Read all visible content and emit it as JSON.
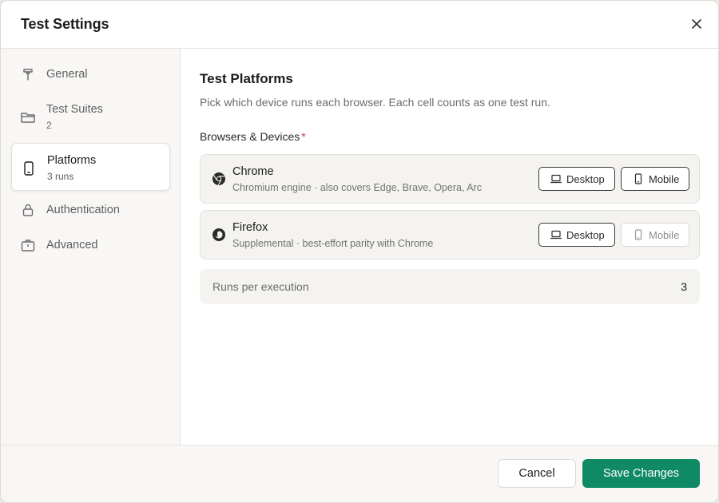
{
  "dialog": {
    "title": "Test Settings",
    "close_icon": "close-icon"
  },
  "sidebar": {
    "items": [
      {
        "label": "General",
        "icon": "hammer-icon"
      },
      {
        "label": "Test Suites",
        "sub": "2",
        "icon": "folder-icon"
      },
      {
        "label": "Platforms",
        "sub": "3 runs",
        "icon": "phone-icon",
        "active": true
      },
      {
        "label": "Authentication",
        "icon": "lock-icon"
      },
      {
        "label": "Advanced",
        "icon": "briefcase-icon"
      }
    ]
  },
  "main": {
    "heading": "Test Platforms",
    "description": "Pick which device runs each browser. Each cell counts as one test run.",
    "section_label": "Browsers & Devices",
    "required_mark": "*",
    "browsers": [
      {
        "name": "Chrome",
        "description": "Chromium engine · also covers Edge, Brave, Opera, Arc",
        "icon": "chrome-icon",
        "desktop_label": "Desktop",
        "mobile_label": "Mobile",
        "desktop_selected": true,
        "mobile_selected": true
      },
      {
        "name": "Firefox",
        "description": "Supplemental · best-effort parity with Chrome",
        "icon": "firefox-icon",
        "desktop_label": "Desktop",
        "mobile_label": "Mobile",
        "desktop_selected": true,
        "mobile_selected": false
      }
    ],
    "runs": {
      "label": "Runs per execution",
      "value": "3"
    }
  },
  "footer": {
    "cancel_label": "Cancel",
    "save_label": "Save Changes"
  },
  "colors": {
    "accent": "#108a64",
    "required": "#d13b3b"
  }
}
